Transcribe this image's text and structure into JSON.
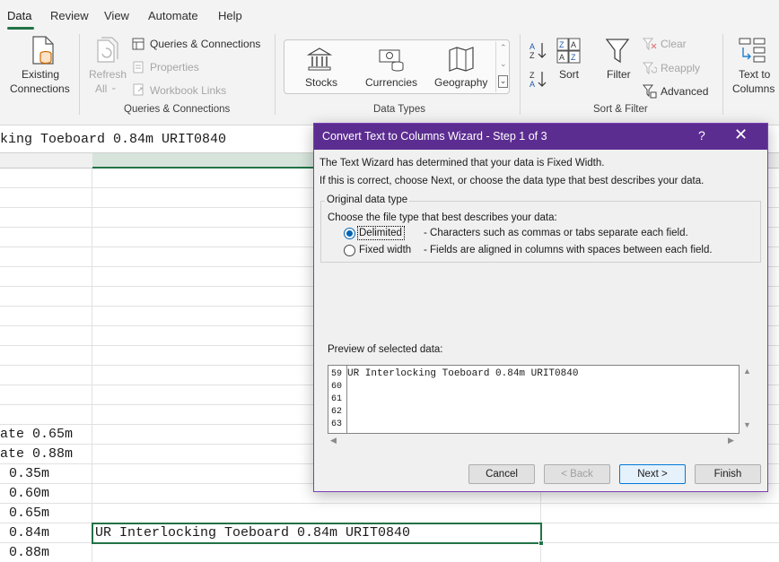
{
  "tabs": [
    "Data",
    "Review",
    "View",
    "Automate",
    "Help"
  ],
  "ribbon": {
    "existing_connections": [
      "Existing",
      "Connections"
    ],
    "refresh_all": [
      "Refresh",
      "All"
    ],
    "queries_connections": "Queries & Connections",
    "properties": "Properties",
    "workbook_links": "Workbook Links",
    "group_queries": "Queries & Connections",
    "stocks": "Stocks",
    "currencies": "Currencies",
    "geography": "Geography",
    "group_datatypes": "Data Types",
    "sort": "Sort",
    "filter": "Filter",
    "clear": "Clear",
    "reapply": "Reapply",
    "advanced": "Advanced",
    "group_sortfilter": "Sort & Filter",
    "text_to_columns": [
      "Text to",
      "Columns"
    ]
  },
  "formula_bar": {
    "text": "king Toeboard 0.84m URIT0840"
  },
  "grid": {
    "cells": [
      "ate 0.65m",
      "ate 0.88m",
      "0.35m",
      "0.60m",
      "0.65m",
      "0.84m",
      "0.88m"
    ],
    "active_cell": "UR Interlocking Toeboard 0.84m URIT0840"
  },
  "dialog": {
    "title": "Convert Text to Columns Wizard - Step 1 of 3",
    "help": "?",
    "close": "✕",
    "line1": "The Text Wizard has determined that your data is Fixed Width.",
    "line2": "If this is correct, choose Next, or choose the data type that best describes your data.",
    "group_label": "Original data type",
    "choose_label": "Choose the file type that best describes your data:",
    "opt_delimited": "Delimited",
    "opt_delimited_desc": "- Characters such as commas or tabs separate each field.",
    "opt_fixed": "Fixed width",
    "opt_fixed_desc": "- Fields are aligned in columns with spaces between each field.",
    "preview_label": "Preview of selected data:",
    "preview_rows": [
      "59",
      "60",
      "61",
      "62",
      "63"
    ],
    "preview_text": "UR Interlocking Toeboard 0.84m URIT0840",
    "buttons": {
      "cancel": "Cancel",
      "back": "< Back",
      "next": "Next >",
      "finish": "Finish"
    }
  },
  "colors": {
    "accent_green": "#217346",
    "dialog_title": "#5c2d91",
    "radio_blue": "#0063b1"
  },
  "icons": [
    "existing-connections-icon",
    "refresh-all-icon",
    "queries-connections-icon",
    "properties-icon",
    "workbook-links-icon",
    "stocks-icon",
    "currencies-icon",
    "geography-icon",
    "sort-az-icon",
    "sort-za-icon",
    "sort-icon",
    "filter-icon",
    "clear-icon",
    "reapply-icon",
    "advanced-icon",
    "text-to-columns-icon"
  ]
}
